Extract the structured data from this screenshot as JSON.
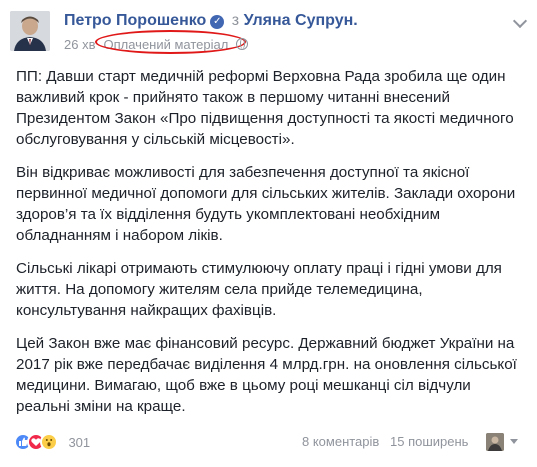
{
  "header": {
    "author": "Петро Порошенко",
    "via_prefix": "з",
    "via_name": "Уляна Супрун.",
    "time": "26 хв",
    "sponsored_label": "Оплачений матеріал"
  },
  "post": {
    "paragraphs": [
      "ПП: Давши старт медичній реформі Верховна Рада зробила ще один важливий крок - прийнято також в першому читанні внесений Президентом Закон «Про підвищення доступності та якості медичного обслуговування у сільській місцевості».",
      "Він відкриває можливості для забезпечення доступної та якісної первинної медичної допомоги для сільських жителів. Заклади охорони здоров’я та їх відділення будуть укомплектовані необхідним обладнанням і набором ліків.",
      "Сільські лікарі отримають стимулюючу оплату праці і гідні умови для життя. На допомогу жителям села прийде телемедицина, консультування найкращих фахівців.",
      "Цей Закон вже має фінансовий ресурс. Державний бюджет України на 2017 рік вже передбачає виділення 4 млрд.грн. на оновлення сільської медицини. Вимагаю, щоб вже в цьому році мешканці сіл відчули реальні зміни на краще."
    ]
  },
  "footer": {
    "reaction_icons": [
      "like-icon",
      "love-icon",
      "wow-icon"
    ],
    "reaction_count": "301",
    "comments": "8 коментарів",
    "shares": "15 поширень"
  },
  "colors": {
    "link": "#365899",
    "highlight_ellipse": "#e01818",
    "like": "#4e8af7",
    "love": "#f0284a",
    "wow": "#fbcd48"
  }
}
